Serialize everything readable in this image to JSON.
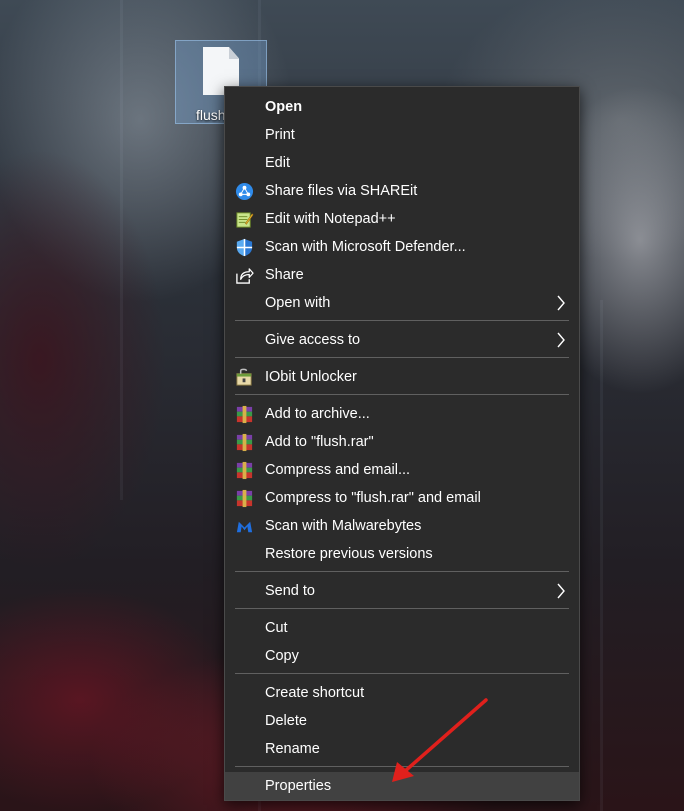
{
  "desktop": {
    "file_label": "flush"
  },
  "menu": {
    "open": "Open",
    "print": "Print",
    "edit": "Edit",
    "share_shareit": "Share files via SHAREit",
    "notepadpp": "Edit with Notepad++",
    "defender": "Scan with Microsoft Defender...",
    "share": "Share",
    "open_with": "Open with",
    "give_access": "Give access to",
    "iobit": "IObit Unlocker",
    "add_archive": "Add to archive...",
    "add_rar": "Add to \"flush.rar\"",
    "compress_email": "Compress and email...",
    "compress_rar_email": "Compress to \"flush.rar\" and email",
    "malwarebytes": "Scan with Malwarebytes",
    "restore": "Restore previous versions",
    "send_to": "Send to",
    "cut": "Cut",
    "copy": "Copy",
    "create_shortcut": "Create shortcut",
    "delete": "Delete",
    "rename": "Rename",
    "properties": "Properties"
  },
  "colors": {
    "menu_bg": "#2b2b2b",
    "menu_hover": "#414141",
    "separator": "#606060",
    "arrow": "#e0201c"
  }
}
